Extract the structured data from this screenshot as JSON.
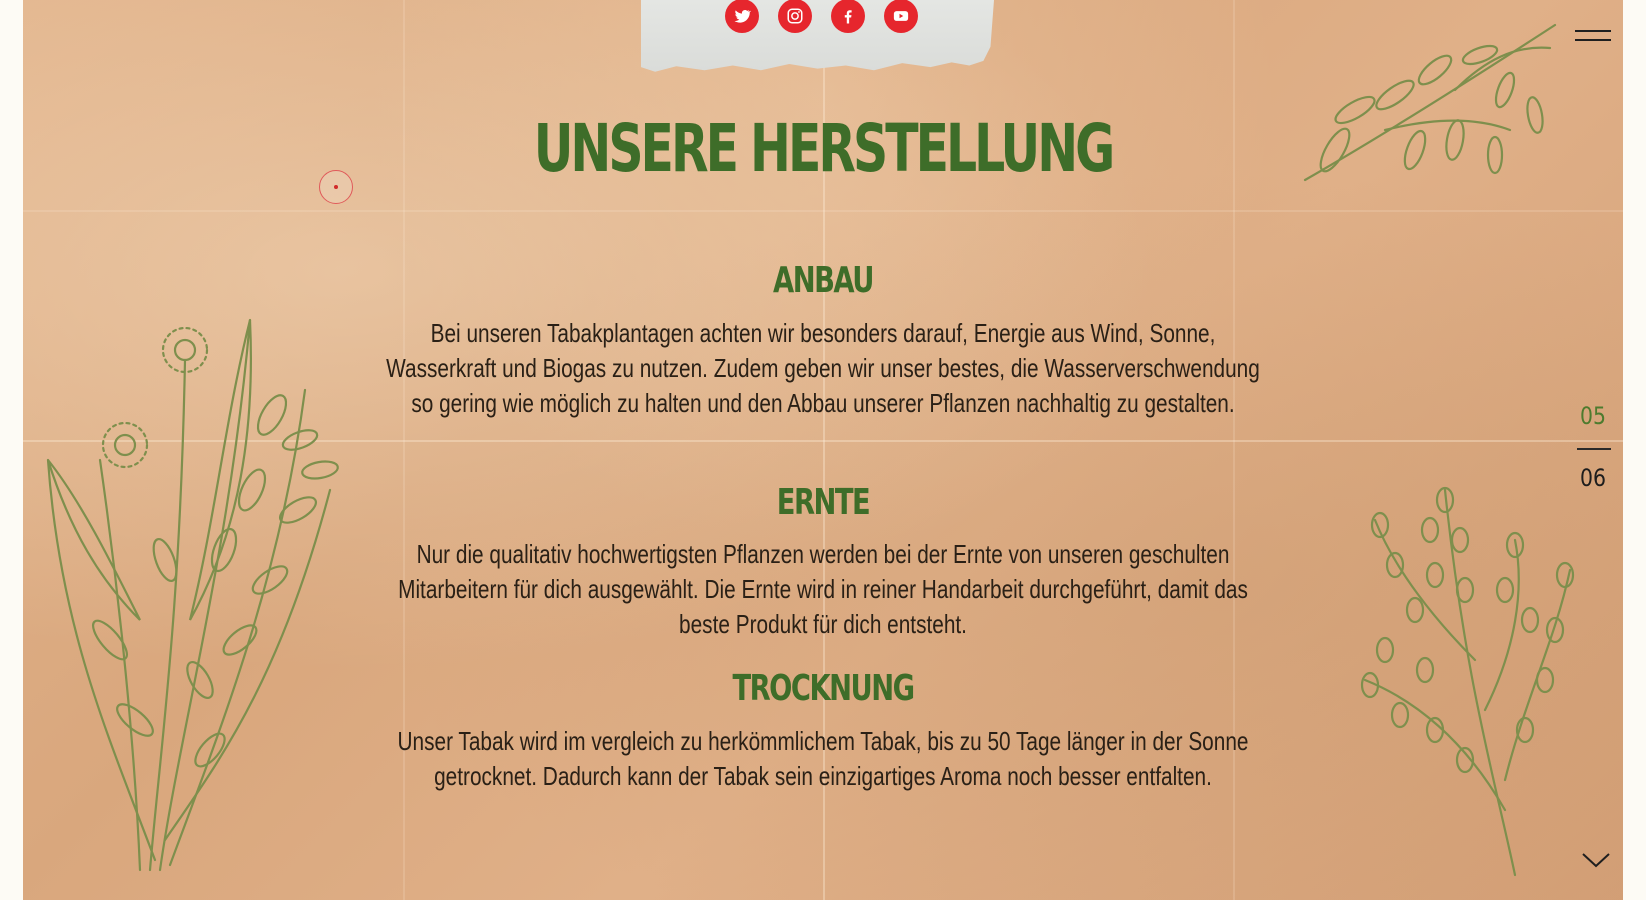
{
  "social": {
    "links": [
      {
        "name": "twitter",
        "icon": "twitter-icon"
      },
      {
        "name": "instagram",
        "icon": "instagram-icon"
      },
      {
        "name": "facebook",
        "icon": "facebook-icon"
      },
      {
        "name": "youtube",
        "icon": "youtube-icon"
      }
    ],
    "icon_color": "#e6262d"
  },
  "page": {
    "title": "UNSERE HERSTELLUNG",
    "accent_color": "#3e6d29"
  },
  "sections": [
    {
      "heading": "ANBAU",
      "text": "Bei unseren Tabakplantagen achten wir besonders darauf, Energie aus Wind, Sonne, Wasserkraft und Biogas zu nutzen. Zudem geben wir unser bestes, die Wasserverschwendung so gering wie möglich zu halten und den Abbau unserer Pflanzen nachhaltig zu gestalten."
    },
    {
      "heading": "ERNTE",
      "text": "Nur die qualitativ hochwertigsten Pflanzen werden bei der Ernte von unseren geschulten Mitarbeitern für dich ausgewählt. Die Ernte wird in reiner Handarbeit durchgeführt, damit das beste Produkt für dich entsteht."
    },
    {
      "heading": "TROCKNUNG",
      "text": "Unser Tabak wird im vergleich zu herkömmlichem Tabak, bis zu 50 Tage länger in der Sonne getrocknet. Dadurch kann der Tabak sein einzigartiges Aroma noch besser entfalten."
    }
  ],
  "pager": {
    "current": "05",
    "total": "06"
  },
  "nav": {
    "menu_icon": "hamburger-icon",
    "down_icon": "chevron-down-icon"
  }
}
